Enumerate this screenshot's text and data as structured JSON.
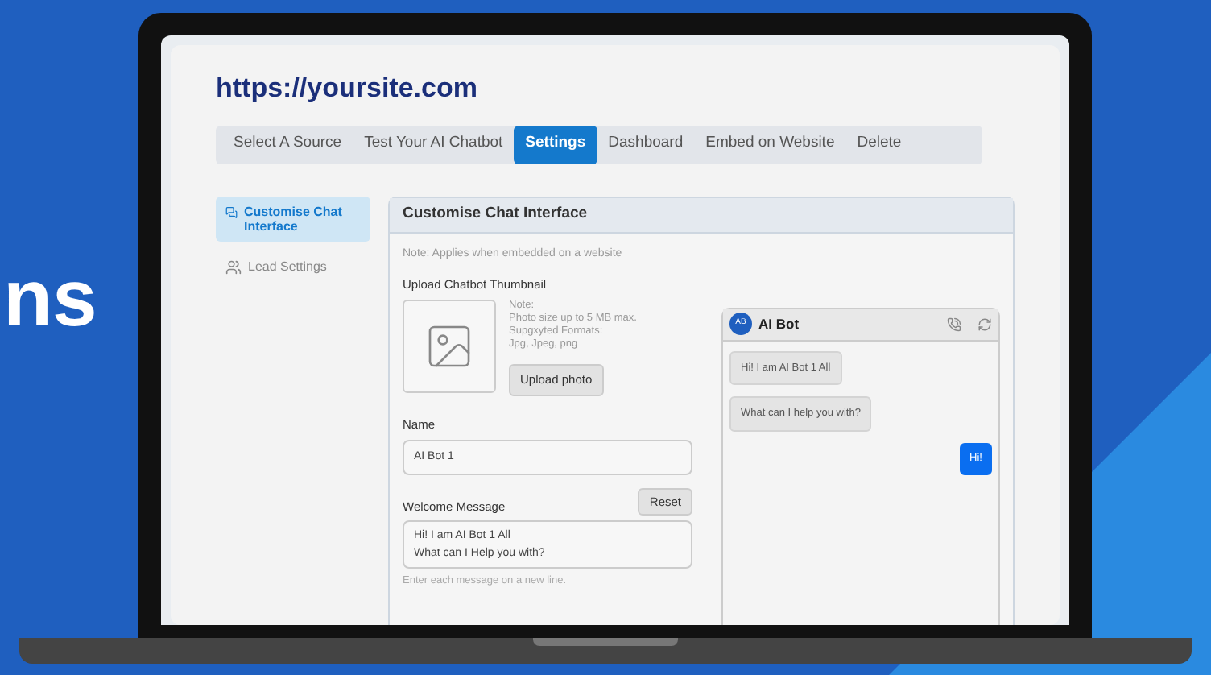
{
  "background_text": "ns",
  "site_url": "https://yoursite.com",
  "tabs": [
    {
      "label": "Select A Source",
      "selected": false
    },
    {
      "label": "Test Your AI Chatbot",
      "selected": false
    },
    {
      "label": "Settings",
      "selected": true
    },
    {
      "label": "Dashboard",
      "selected": false
    },
    {
      "label": "Embed on Website",
      "selected": false
    },
    {
      "label": "Delete",
      "selected": false
    }
  ],
  "sidebar": {
    "items": [
      {
        "label": "Customise Chat Interface",
        "kind": "chat",
        "selected": true
      },
      {
        "label": "Lead Settings",
        "kind": "users",
        "selected": false
      }
    ]
  },
  "panel": {
    "title": "Customise Chat Interface",
    "note": "Note: Applies when embedded on a website",
    "thumbnail": {
      "label": "Upload Chatbot Thumbnail",
      "note_lines": [
        "Note:",
        "Photo size up to 5 MB max.",
        "Supgxyted Formats:",
        "Jpg, Jpeg, png"
      ],
      "button": "Upload photo"
    },
    "name": {
      "label": "Name",
      "value": "AI Bot 1"
    },
    "welcome": {
      "label": "Welcome Message",
      "reset": "Reset",
      "lines": [
        "Hi! I am AI Bot 1 All",
        "What can I Help you with?"
      ],
      "hint": "Enter each message on a new line."
    }
  },
  "chat_preview": {
    "avatar": "AB",
    "title": "AI Bot",
    "messages": [
      {
        "kind": "bot",
        "text": "Hi! I am AI Bot 1 All"
      },
      {
        "kind": "bot",
        "text": "What can I help you with?"
      },
      {
        "kind": "user",
        "text": "Hi!"
      }
    ]
  }
}
